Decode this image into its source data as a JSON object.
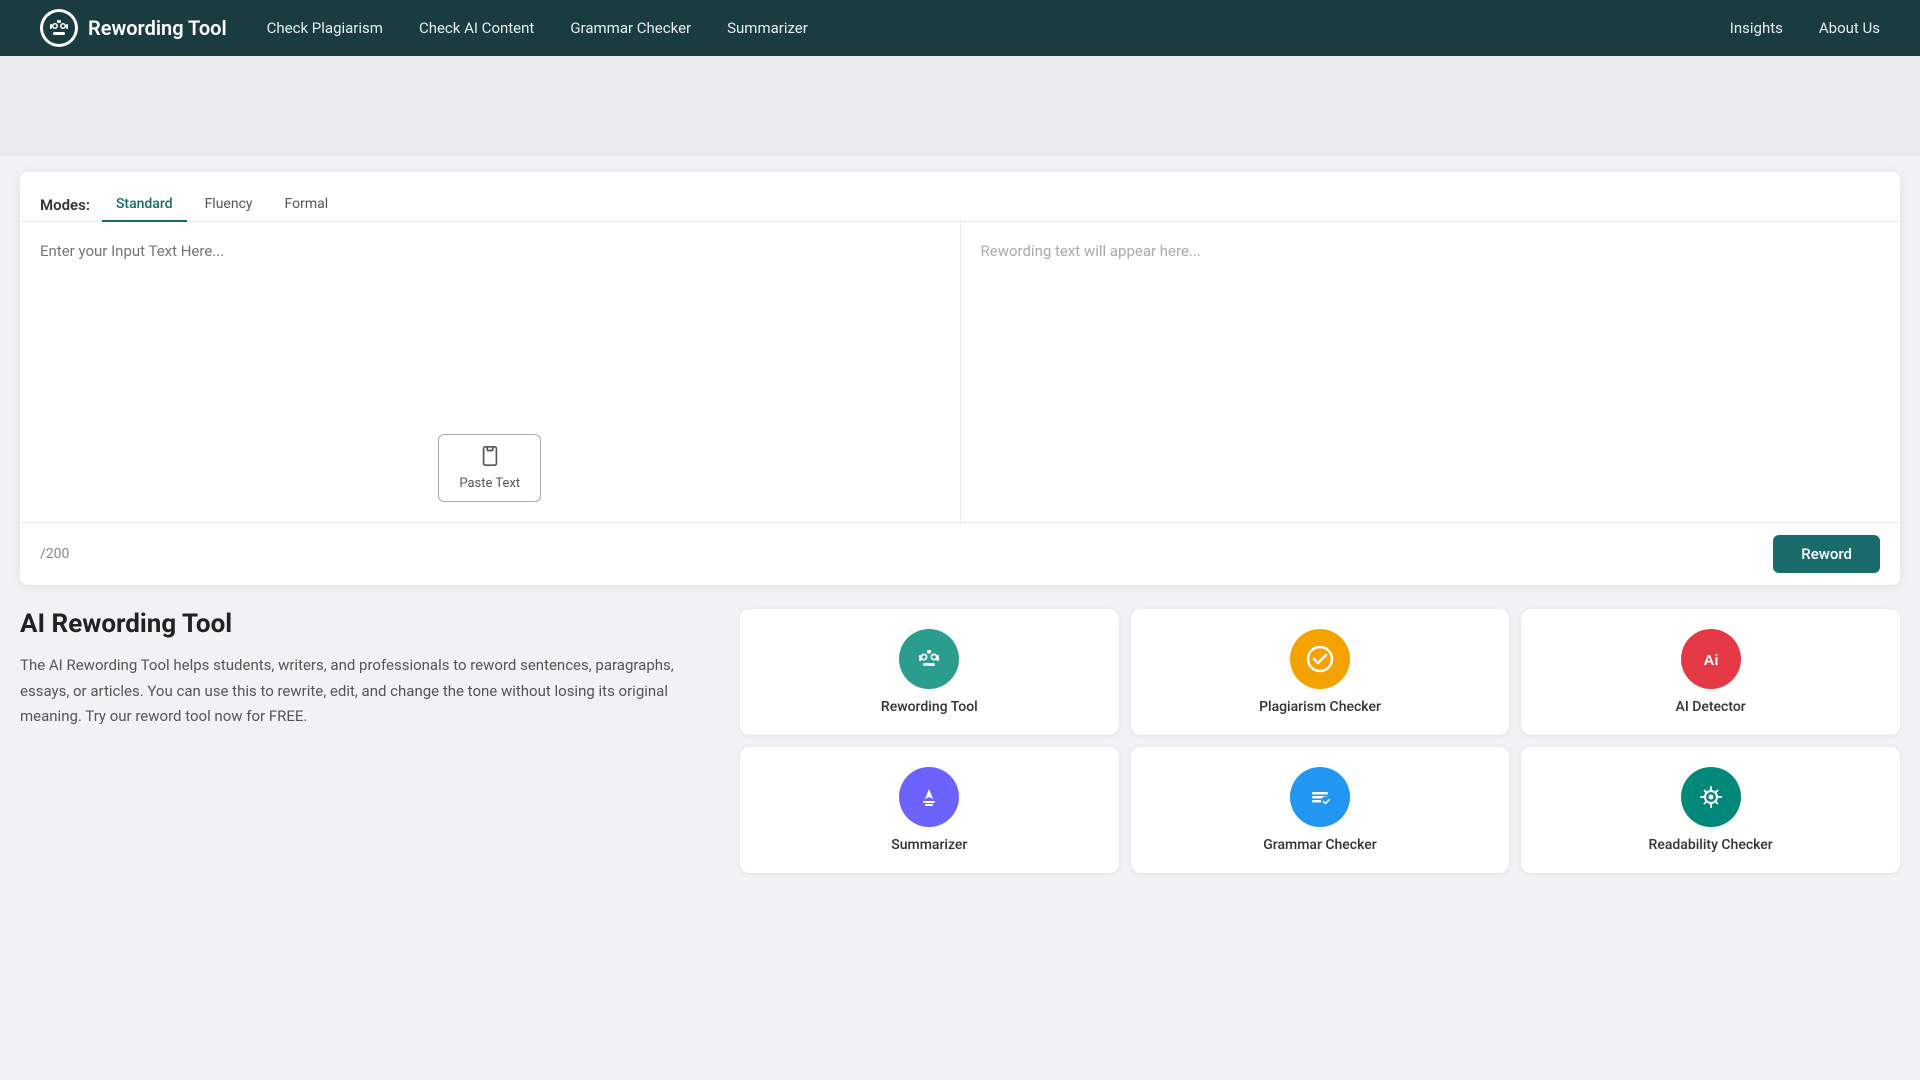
{
  "header": {
    "logo_text": "Rewording Tool",
    "nav_items": [
      {
        "label": "Check Plagiarism",
        "id": "check-plagiarism"
      },
      {
        "label": "Check AI Content",
        "id": "check-ai-content"
      },
      {
        "label": "Grammar Checker",
        "id": "grammar-checker"
      },
      {
        "label": "Summarizer",
        "id": "summarizer"
      }
    ],
    "right_nav": [
      {
        "label": "Insights",
        "id": "insights"
      },
      {
        "label": "About Us",
        "id": "about-us"
      }
    ]
  },
  "modes": {
    "label": "Modes:",
    "tabs": [
      {
        "label": "Standard",
        "active": true
      },
      {
        "label": "Fluency",
        "active": false
      },
      {
        "label": "Formal",
        "active": false
      }
    ]
  },
  "input_area": {
    "placeholder": "Enter your Input Text Here..."
  },
  "output_area": {
    "placeholder": "Rewording text will appear here..."
  },
  "paste_button": {
    "label": "Paste Text"
  },
  "char_count": {
    "text": "/200"
  },
  "reword_button": {
    "label": "Reword"
  },
  "description": {
    "title": "AI Rewording Tool",
    "body": "The AI Rewording Tool helps students, writers, and professionals to reword sentences, paragraphs, essays, or articles. You can use this to rewrite, edit, and change the tone without losing its original meaning. Try our reword tool now for FREE."
  },
  "tools": [
    {
      "name": "Rewording Tool",
      "icon_type": "teal",
      "icon_char": "🤖"
    },
    {
      "name": "Plagiarism Checker",
      "icon_type": "yellow",
      "icon_char": "✔"
    },
    {
      "name": "AI Detector",
      "icon_type": "red",
      "icon_char": "Ai"
    },
    {
      "name": "Summarizer",
      "icon_type": "purple",
      "icon_char": "✏"
    },
    {
      "name": "Grammar Checker",
      "icon_type": "blue",
      "icon_char": "≡"
    },
    {
      "name": "Readability Checker",
      "icon_type": "teal2",
      "icon_char": "⚙"
    }
  ]
}
